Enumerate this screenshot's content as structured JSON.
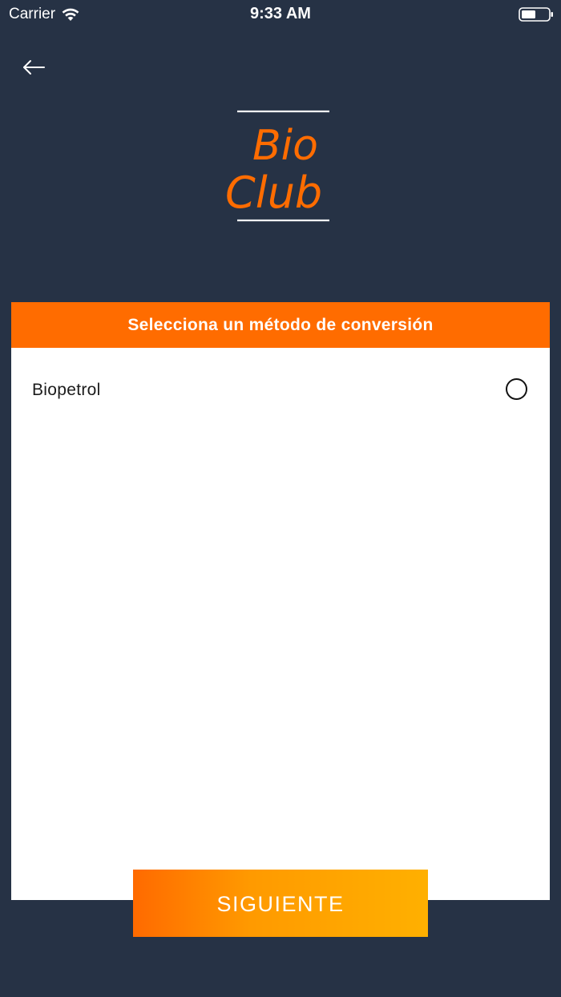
{
  "status_bar": {
    "carrier": "Carrier",
    "time": "9:33 AM",
    "wifi_icon": "wifi-icon",
    "battery_icon": "battery-icon"
  },
  "nav": {
    "back_icon": "arrow-left-icon"
  },
  "logo": {
    "line1": "Bio",
    "line2": "Club",
    "color": "#ff6c00"
  },
  "card": {
    "title": "Selecciona un método de conversión",
    "options": [
      {
        "label": "Biopetrol",
        "selected": false
      }
    ]
  },
  "footer": {
    "next_label": "SIGUIENTE"
  },
  "colors": {
    "background": "#263245",
    "accent": "#ff6c00",
    "button_gradient_start": "#ff6a00",
    "button_gradient_end": "#ffb000",
    "card": "#ffffff"
  }
}
